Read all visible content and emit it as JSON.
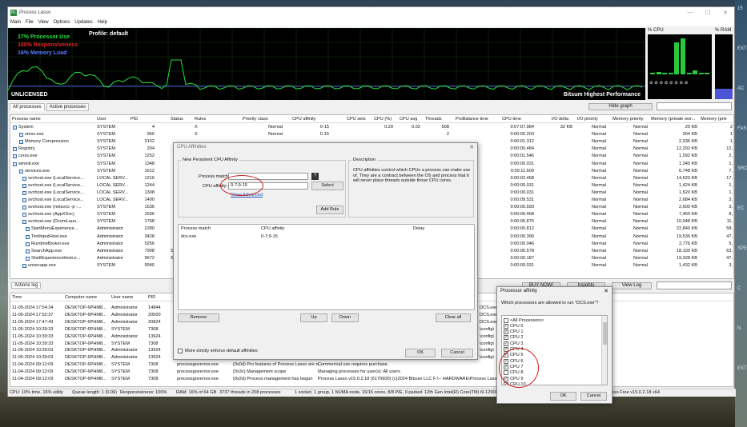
{
  "app": {
    "title": "Process Lasso",
    "icon": "PL",
    "window_controls": [
      "—",
      "☐",
      "✕"
    ]
  },
  "menu": [
    "Main",
    "File",
    "View",
    "Options",
    "Updates",
    "Help"
  ],
  "graph": {
    "proc": "17% Processor Use",
    "resp": "100% Responsiveness",
    "mem": "16% Memory Load",
    "profile": "Profile: default",
    "unlicensed": "UNLICENSED",
    "power": "Bitsum Highest Performance"
  },
  "cpu_panel": {
    "label": "% CPU",
    "core_loads": [
      0.02,
      0.06,
      0.02,
      0.03,
      0.8,
      0.9,
      0.03,
      0.1,
      0.03,
      0.02
    ],
    "icons": "⊘ ⊘ ⊘ ⊘ ⊘ ⊘ ⊘ ⊘"
  },
  "ram_panel": {
    "label": "% RAM",
    "load": 0.16
  },
  "tabs": [
    "All processes",
    "Active processes"
  ],
  "hide_graph": "Hide graph",
  "proc_columns": [
    "Process name",
    "User",
    "PID",
    "Status",
    "Rules",
    "Priority class",
    "CPU affinity",
    "CPU sets",
    "CPU (%)",
    "CPU avg",
    "Threads",
    "ProBalance time",
    "CPU time",
    "I/O delta",
    "I/O priority",
    "Memory priority",
    "Memory (private wor...",
    "Memory (priv"
  ],
  "processes": [
    [
      "System",
      "SYSTEM",
      "4",
      "",
      "X",
      "Normal",
      "0-15",
      "",
      "0.29",
      "0.02",
      "508",
      "",
      "0:07:07.984",
      "32 KB",
      "Normal",
      "Normal",
      "20 KB",
      "2"
    ],
    [
      "smss.exe",
      "SYSTEM",
      "960",
      "",
      "X",
      "Normal",
      "0-15",
      "",
      "",
      "",
      "2",
      "",
      "0:00:00.203",
      "",
      "Normal",
      "Normal",
      "304 KB",
      "1"
    ],
    [
      "Memory Compression",
      "SYSTEM",
      "3152",
      "",
      "",
      "",
      "",
      "",
      "",
      "",
      "",
      "",
      "0:00:01.312",
      "",
      "Normal",
      "Normal",
      "2,336 KB",
      "1"
    ],
    [
      "Registry",
      "SYSTEM",
      "204",
      "",
      "",
      "",
      "",
      "",
      "",
      "",
      "",
      "",
      "0:00:00.484",
      "",
      "Normal",
      "Normal",
      "12,292 KB",
      "12,"
    ],
    [
      "csrss.exe",
      "SYSTEM",
      "1252",
      "",
      "",
      "",
      "",
      "",
      "",
      "",
      "",
      "",
      "0:00:01.546",
      "",
      "Normal",
      "Normal",
      "1,592 KB",
      "2,"
    ],
    [
      "wininit.exe",
      "SYSTEM",
      "1348",
      "",
      "",
      "",
      "",
      "",
      "",
      "",
      "",
      "",
      "0:00:00.031",
      "",
      "Normal",
      "Normal",
      "1,340 KB",
      "1,"
    ],
    [
      "services.exe",
      "SYSTEM",
      "1612",
      "",
      "",
      "",
      "",
      "",
      "",
      "",
      "",
      "",
      "0:00:11.609",
      "",
      "Normal",
      "Normal",
      "6,748 KB",
      "7,"
    ],
    [
      "svchost.exe (LocalService...",
      "LOCAL SERV...",
      "1216",
      "",
      "",
      "",
      "",
      "",
      "",
      "",
      "",
      "",
      "0:00:02.468",
      "",
      "Normal",
      "Normal",
      "14,620 KB",
      "17,"
    ],
    [
      "svchost.exe (LocalService...",
      "LOCAL SERV...",
      "1244",
      "",
      "",
      "",
      "",
      "",
      "",
      "",
      "",
      "",
      "0:00:00.031",
      "",
      "Normal",
      "Normal",
      "1,424 KB",
      "1,"
    ],
    [
      "svchost.exe (LocalService...",
      "LOCAL SERV...",
      "1308",
      "",
      "",
      "",
      "",
      "",
      "",
      "",
      "",
      "",
      "0:00:00.031",
      "",
      "Normal",
      "Normal",
      "1,520 KB",
      "1,"
    ],
    [
      "svchost.exe (LocalService...",
      "LOCAL SERV...",
      "1400",
      "",
      "",
      "",
      "",
      "",
      "",
      "",
      "",
      "",
      "0:00:09.531",
      "",
      "Normal",
      "Normal",
      "2,684 KB",
      "3,"
    ],
    [
      "svchost.exe (netsvcs -p -...",
      "SYSTEM",
      "1636",
      "",
      "",
      "",
      "",
      "",
      "",
      "",
      "",
      "",
      "0:00:00.593",
      "",
      "Normal",
      "Normal",
      "2,600 KB",
      "3,"
    ],
    [
      "svchost.exe (AppXSvc)",
      "SYSTEM",
      "1696",
      "",
      "",
      "",
      "",
      "",
      "",
      "",
      "",
      "",
      "0:00:00.468",
      "",
      "Normal",
      "Normal",
      "7,460 KB",
      "8,"
    ],
    [
      "svchost.exe (DcomLaun...",
      "SYSTEM",
      "1768",
      "",
      "",
      "",
      "",
      "",
      "",
      "",
      "",
      "",
      "0:00:05.875",
      "",
      "Normal",
      "Normal",
      "10,048 KB",
      "11,"
    ],
    [
      "StartMenuExperience...",
      "Administrator",
      "2280",
      "",
      "",
      "",
      "",
      "",
      "",
      "",
      "",
      "",
      "0:00:00.812",
      "",
      "Normal",
      "Normal",
      "22,840 KB",
      "58,"
    ],
    [
      "TextInputHost.exe",
      "Administrator",
      "3428",
      "",
      "",
      "",
      "",
      "",
      "",
      "",
      "",
      "",
      "0:00:00.390",
      "",
      "Normal",
      "Normal",
      "19,536 KB",
      "47,"
    ],
    [
      "RuntimeBroker.exe",
      "Administrator",
      "5256",
      "",
      "",
      "",
      "",
      "",
      "",
      "",
      "",
      "",
      "0:00:00.046",
      "",
      "Normal",
      "Normal",
      "2,776 KB",
      "5,"
    ],
    [
      "SearchApp.exe",
      "Administrator",
      "7908",
      "Susper",
      "",
      "",
      "",
      "",
      "",
      "",
      "",
      "",
      "0:00:00.578",
      "",
      "Normal",
      "Normal",
      "18,100 KB",
      "63,"
    ],
    [
      "ShellExperienceHost.e...",
      "Administrator",
      "9672",
      "Susper",
      "",
      "",
      "",
      "",
      "",
      "",
      "",
      "",
      "0:00:00.187",
      "",
      "Normal",
      "Normal",
      "19,328 KB",
      "47,"
    ],
    [
      "unsecapp.exe",
      "SYSTEM",
      "9940",
      "",
      "",
      "",
      "",
      "",
      "",
      "",
      "",
      "",
      "0:00:00.031",
      "",
      "Normal",
      "Normal",
      "1,432 KB",
      "3,"
    ]
  ],
  "actions": {
    "tab": "Actions log",
    "buy": "BUY NOW!",
    "insights": "Insights",
    "view_log": "View Log",
    "columns": [
      "Time",
      "Computer name",
      "User name",
      "PID",
      "Process name",
      "Action",
      "More info"
    ],
    "rows": [
      [
        "11-05-2024 17:54:34",
        "DESKTOP-6PHM8...",
        "Administrator",
        "14844",
        "",
        "",
        "DCS.exe"
      ],
      [
        "11-05-2024 17:52:37",
        "DESKTOP-6PHM8...",
        "Administrator",
        "20500",
        "",
        "",
        "DCS.exe"
      ],
      [
        "11-05-2024 17:47:43",
        "DESKTOP-6PHM8...",
        "Administrator",
        "20824",
        "",
        "",
        "DCS.exe"
      ],
      [
        "11-05-2024 10:39:33",
        "DESKTOP-6PHM8...",
        "SYSTEM",
        "7308",
        "",
        "",
        "\\config\\"
      ],
      [
        "11-05-2024 10:39:33",
        "DESKTOP-6PHM8...",
        "Administrator",
        "13924",
        "",
        "",
        "\\config\\"
      ],
      [
        "11-05-2024 10:39:33",
        "DESKTOP-6PHM8...",
        "SYSTEM",
        "7308",
        "",
        "",
        "\\config\\"
      ],
      [
        "11-05-2024 10:39:03",
        "DESKTOP-6PHM8...",
        "Administrator",
        "13924",
        "",
        "",
        "\\config\\"
      ],
      [
        "11-05-2024 10:39:03",
        "DESKTOP-6PHM8...",
        "Administrator",
        "13924",
        "",
        "",
        "\\config\\"
      ],
      [
        "11-04-2024 09:12:09",
        "DESKTOP-6PHM8...",
        "SYSTEM",
        "7308",
        "processgovernor.exe",
        "(0x0d) Pro features of Process Lasso are n...",
        "Commercial use requires purchase."
      ],
      [
        "11-04-2024 09:12:09",
        "DESKTOP-6PHM8...",
        "SYSTEM",
        "7308",
        "processgovernor.exe",
        "(0x3c) Management scope",
        "Managing processes for user(s): All users"
      ],
      [
        "11-04-2024 09:12:09",
        "DESKTOP-6PHM8...",
        "SYSTEM",
        "7308",
        "processgovernor.exe",
        "(0x2d) Process management has begun",
        "Process Lasso v15.0.2.18 (6170600) (c)2024 Bitsum LLC   F:\\-- HARDWARE\\Process Lasso"
      ]
    ]
  },
  "status": {
    "cpu": "CPU: 10% time, 16% utility",
    "queue": "Queue length: 1 (0.06)",
    "resp": "Responsiveness: 100%",
    "ram": "RAM: 16% of 64 GB",
    "threads": "3737 threads in 208 processes",
    "sockets": "1 socket, 1 group, 1 NUMA node, 16/16 cores, 8/8 P/E, 0 parked",
    "cpuname": "12th Gen Intel(R) Core(TM) i9-12900K",
    "version": "sso Free v15.0.2.18 x64"
  },
  "affinity_dialog": {
    "title": "CPU Affinities",
    "group": "New Persistent CPU Affinity",
    "process_match_label": "Process match:",
    "process_match_value": "",
    "cpu_affinity_label": "CPU affinity:",
    "cpu_affinity_value": "0-7;9-15",
    "select": "Select",
    "show_advanced": "Show Advanced",
    "add_rule": "Add Rule",
    "desc_title": "Description",
    "desc_text": "CPU affinities control which CPUs a process can make use of. They are a contract between the OS and process that it will never place threads outside those CPU cores.",
    "list_columns": [
      "Process match",
      "CPU affinity",
      "Delay"
    ],
    "list_rows": [
      [
        "dcs.exe",
        "0-7;9-15",
        ""
      ]
    ],
    "remove": "Remove",
    "up": "Up",
    "down": "Down",
    "clear_all": "Clear all",
    "enforce_label": "More strictly enforce default affinities",
    "ok": "OK",
    "cancel": "Cancel"
  },
  "processor_dialog": {
    "title": "Processor affinity",
    "question": "Which processors are allowed to run \"DCS.exe\"?",
    "items": [
      {
        "label": "<All Processors>",
        "checked": false
      },
      {
        "label": "CPU 0",
        "checked": true
      },
      {
        "label": "CPU 1",
        "checked": true
      },
      {
        "label": "CPU 2",
        "checked": true
      },
      {
        "label": "CPU 3",
        "checked": true
      },
      {
        "label": "CPU 4",
        "checked": true
      },
      {
        "label": "CPU 5",
        "checked": true
      },
      {
        "label": "CPU 6",
        "checked": true
      },
      {
        "label": "CPU 7",
        "checked": true
      },
      {
        "label": "CPU 8",
        "checked": false
      },
      {
        "label": "CPU 9",
        "checked": true
      },
      {
        "label": "CPU 10",
        "checked": true
      }
    ],
    "ok": "OK",
    "cancel": "Cancel"
  },
  "desktop_side": [
    "15",
    "EXT",
    "AC",
    "FAS",
    "SRC",
    "EC",
    "SPEE",
    "C",
    "N",
    "EXT"
  ]
}
